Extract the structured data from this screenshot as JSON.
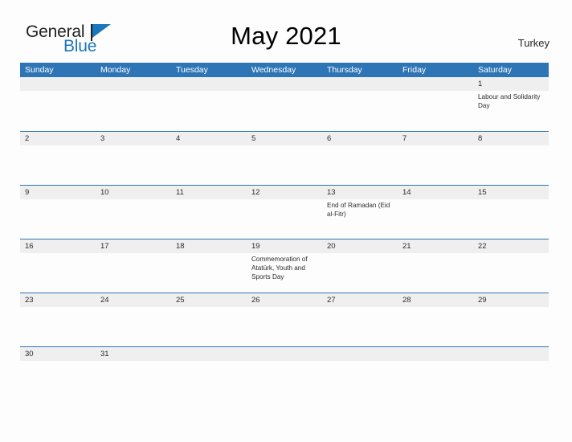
{
  "brand": {
    "word_one": "General",
    "word_two": "Blue",
    "accent_color": "#1b76bc",
    "flag_icon": "triangle-flag-icon"
  },
  "header": {
    "title": "May 2021",
    "country": "Turkey"
  },
  "calendar": {
    "header_bg": "#2e75b6",
    "band_bg": "#efefef",
    "rule_color": "#2e75b6",
    "day_names": [
      "Sunday",
      "Monday",
      "Tuesday",
      "Wednesday",
      "Thursday",
      "Friday",
      "Saturday"
    ],
    "weeks": [
      [
        {
          "day": "",
          "event": ""
        },
        {
          "day": "",
          "event": ""
        },
        {
          "day": "",
          "event": ""
        },
        {
          "day": "",
          "event": ""
        },
        {
          "day": "",
          "event": ""
        },
        {
          "day": "",
          "event": ""
        },
        {
          "day": "1",
          "event": "Labour and Solidarity Day"
        }
      ],
      [
        {
          "day": "2",
          "event": ""
        },
        {
          "day": "3",
          "event": ""
        },
        {
          "day": "4",
          "event": ""
        },
        {
          "day": "5",
          "event": ""
        },
        {
          "day": "6",
          "event": ""
        },
        {
          "day": "7",
          "event": ""
        },
        {
          "day": "8",
          "event": ""
        }
      ],
      [
        {
          "day": "9",
          "event": ""
        },
        {
          "day": "10",
          "event": ""
        },
        {
          "day": "11",
          "event": ""
        },
        {
          "day": "12",
          "event": ""
        },
        {
          "day": "13",
          "event": "End of Ramadan (Eid al-Fitr)"
        },
        {
          "day": "14",
          "event": ""
        },
        {
          "day": "15",
          "event": ""
        }
      ],
      [
        {
          "day": "16",
          "event": ""
        },
        {
          "day": "17",
          "event": ""
        },
        {
          "day": "18",
          "event": ""
        },
        {
          "day": "19",
          "event": "Commemoration of Atatürk, Youth and Sports Day"
        },
        {
          "day": "20",
          "event": ""
        },
        {
          "day": "21",
          "event": ""
        },
        {
          "day": "22",
          "event": ""
        }
      ],
      [
        {
          "day": "23",
          "event": ""
        },
        {
          "day": "24",
          "event": ""
        },
        {
          "day": "25",
          "event": ""
        },
        {
          "day": "26",
          "event": ""
        },
        {
          "day": "27",
          "event": ""
        },
        {
          "day": "28",
          "event": ""
        },
        {
          "day": "29",
          "event": ""
        }
      ],
      [
        {
          "day": "30",
          "event": ""
        },
        {
          "day": "31",
          "event": ""
        },
        {
          "day": "",
          "event": ""
        },
        {
          "day": "",
          "event": ""
        },
        {
          "day": "",
          "event": ""
        },
        {
          "day": "",
          "event": ""
        },
        {
          "day": "",
          "event": ""
        }
      ]
    ]
  }
}
